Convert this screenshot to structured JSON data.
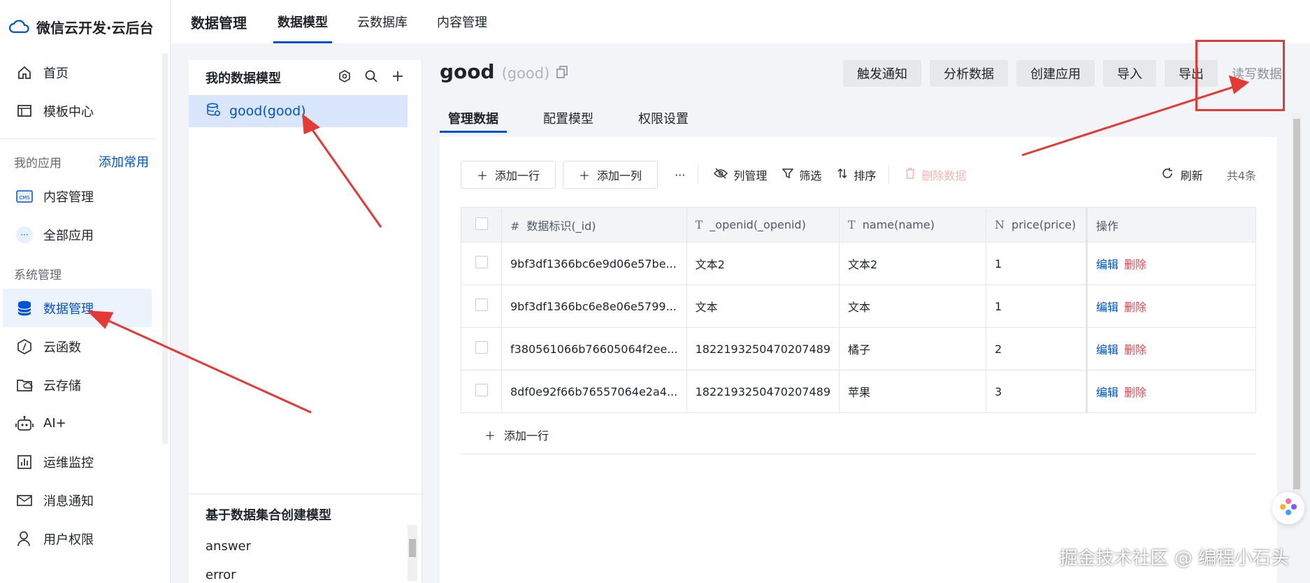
{
  "brand": {
    "title": "微信云开发·云后台",
    "accent": "#0052d9"
  },
  "sidebar": {
    "top_items": [
      {
        "label": "首页",
        "icon": "home-icon"
      },
      {
        "label": "模板中心",
        "icon": "template-icon"
      }
    ],
    "my_apps": {
      "label": "我的应用",
      "link": "添加常用"
    },
    "app_items": [
      {
        "label": "内容管理",
        "icon": "cms-icon"
      },
      {
        "label": "全部应用",
        "icon": "more-icon"
      }
    ],
    "system": {
      "label": "系统管理"
    },
    "system_items": [
      {
        "label": "数据管理",
        "icon": "database-icon",
        "active": true
      },
      {
        "label": "云函数",
        "icon": "function-icon"
      },
      {
        "label": "云存储",
        "icon": "storage-icon"
      },
      {
        "label": "AI+",
        "icon": "robot-icon"
      },
      {
        "label": "运维监控",
        "icon": "monitor-icon"
      },
      {
        "label": "消息通知",
        "icon": "message-icon"
      },
      {
        "label": "用户权限",
        "icon": "user-icon"
      }
    ]
  },
  "topbar": {
    "title": "数据管理",
    "tabs": [
      "数据模型",
      "云数据库",
      "内容管理"
    ]
  },
  "model_panel": {
    "title": "我的数据模型",
    "active_model": "good(good)",
    "collection_title": "基于数据集合创建模型",
    "collections": [
      "answer",
      "error"
    ]
  },
  "detail": {
    "name": "good",
    "sub": "(good)",
    "actions": [
      "触发通知",
      "分析数据",
      "创建应用",
      "导入",
      "导出"
    ],
    "rw_label": "读写数据",
    "tabs": [
      "管理数据",
      "配置模型",
      "权限设置"
    ]
  },
  "toolbar": {
    "add_row": "添加一行",
    "add_col": "添加一列",
    "more": "···",
    "col_manage": "列管理",
    "filter": "筛选",
    "sort": "排序",
    "delete": "删除数据",
    "refresh": "刷新",
    "total": "共4条"
  },
  "table": {
    "columns": [
      {
        "icon": "#",
        "label": "数据标识(_id)"
      },
      {
        "icon": "T",
        "label": "_openid(_openid)"
      },
      {
        "icon": "T",
        "label": "name(name)"
      },
      {
        "icon": "N",
        "label": "price(price)"
      }
    ],
    "op_label": "操作",
    "rows": [
      {
        "id": "9bf3df1366bc6e9d06e57be...",
        "openid": "文本2",
        "name": "文本2",
        "price": "1"
      },
      {
        "id": "9bf3df1366bc6e8e06e5799...",
        "openid": "文本",
        "name": "文本",
        "price": "1"
      },
      {
        "id": "f380561066b76605064f2ee...",
        "openid": "1822193250470207489",
        "name": "橘子",
        "price": "2"
      },
      {
        "id": "8df0e92f66b76557064e2a4...",
        "openid": "1822193250470207489",
        "name": "苹果",
        "price": "3"
      }
    ],
    "edit": "编辑",
    "del": "删除",
    "add_row": "添加一行"
  },
  "watermark": "掘金技术社区 @ 编程小石头"
}
